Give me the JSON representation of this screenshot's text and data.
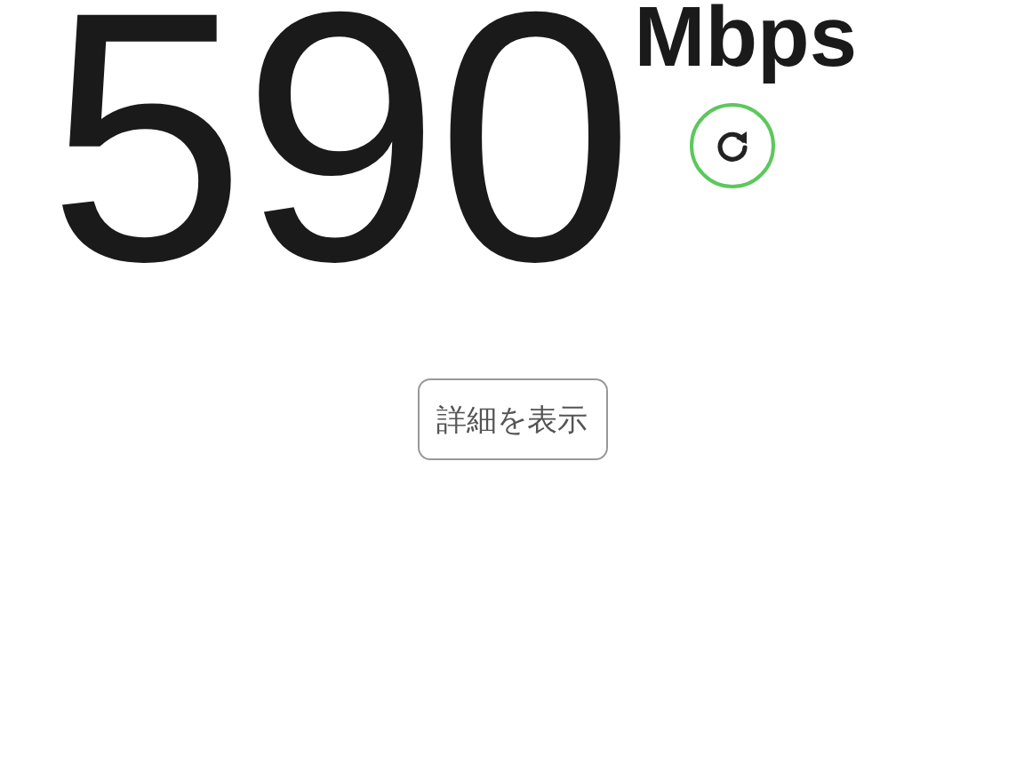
{
  "speed": {
    "value": "590",
    "unit": "Mbps"
  },
  "details_button": {
    "label": "詳細を表示"
  }
}
